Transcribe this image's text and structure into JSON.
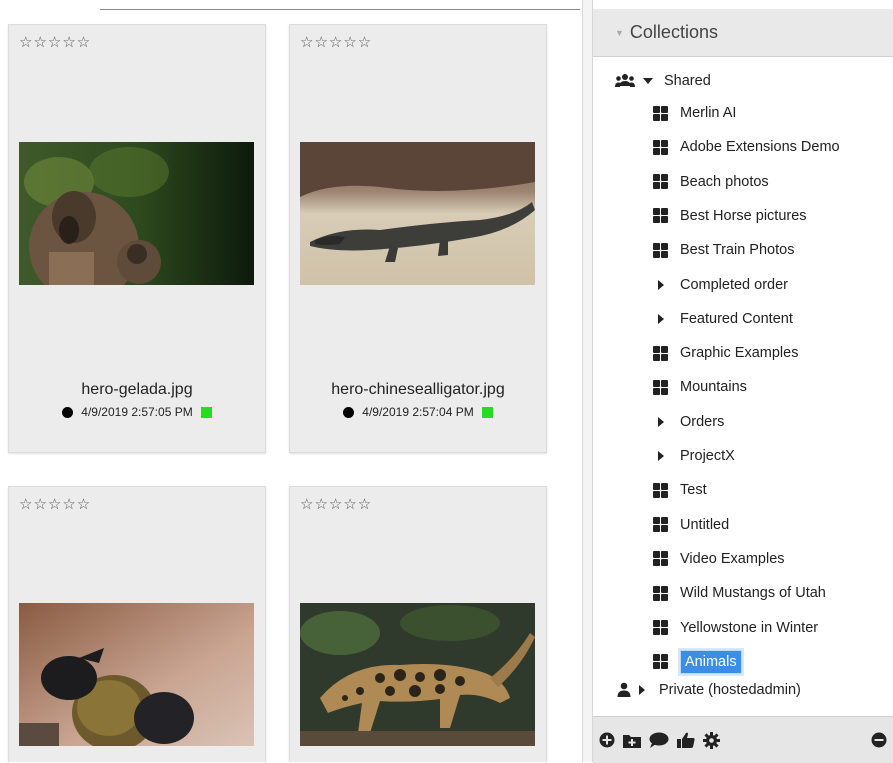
{
  "cards": [
    {
      "rating": "☆☆☆☆☆",
      "filename": "hero-gelada.jpg",
      "date": "4/9/2019 2:57:05 PM"
    },
    {
      "rating": "☆☆☆☆☆",
      "filename": "hero-chinesealligator.jpg",
      "date": "4/9/2019 2:57:04 PM"
    },
    {
      "rating": "☆☆☆☆☆"
    },
    {
      "rating": "☆☆☆☆☆"
    }
  ],
  "panel": {
    "title": "Collections",
    "shared": {
      "label": "Shared",
      "items": [
        {
          "label": "Merlin AI",
          "icon": "collection-grid-icon"
        },
        {
          "label": "Adobe Extensions Demo",
          "icon": "collection-grid-icon"
        },
        {
          "label": "Beach photos",
          "icon": "collection-grid-icon"
        },
        {
          "label": "Best Horse pictures",
          "icon": "collection-grid-icon"
        },
        {
          "label": "Best Train Photos",
          "icon": "collection-grid-icon"
        },
        {
          "label": "Completed order",
          "icon": "expand-arrow-icon"
        },
        {
          "label": "Featured Content",
          "icon": "expand-arrow-icon"
        },
        {
          "label": "Graphic Examples",
          "icon": "collection-grid-icon"
        },
        {
          "label": "Mountains",
          "icon": "collection-grid-icon"
        },
        {
          "label": "Orders",
          "icon": "expand-arrow-icon"
        },
        {
          "label": "ProjectX",
          "icon": "expand-arrow-icon"
        },
        {
          "label": "Test",
          "icon": "collection-grid-icon"
        },
        {
          "label": "Untitled",
          "icon": "collection-grid-icon"
        },
        {
          "label": "Video Examples",
          "icon": "collection-grid-icon"
        },
        {
          "label": "Wild Mustangs of Utah",
          "icon": "collection-grid-icon"
        },
        {
          "label": "Yellowstone in Winter",
          "icon": "collection-grid-icon"
        },
        {
          "label": "Animals",
          "icon": "collection-grid-icon",
          "selected": true
        }
      ]
    },
    "private": {
      "label": "Private (hostedadmin)"
    }
  },
  "colors": {
    "accent": "#3a8ee6",
    "status_green": "#22dd22",
    "card_bg": "#ececec"
  }
}
